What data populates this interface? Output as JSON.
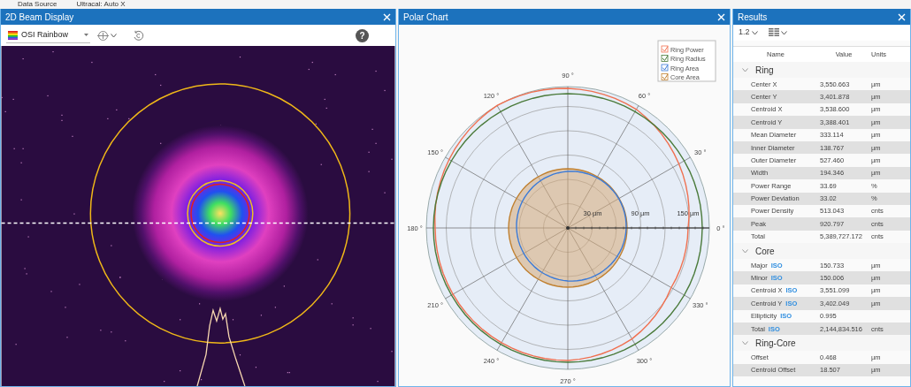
{
  "menu_bar": {
    "items": [
      "Data Source",
      "Ultracal: Auto X"
    ]
  },
  "beam_display": {
    "title": "2D Beam Display",
    "palette": "OSI Rainbow",
    "help": "?"
  },
  "polar_chart": {
    "title": "Polar Chart",
    "legend": [
      {
        "label": "Ring Power",
        "color": "#f07050",
        "checked": true
      },
      {
        "label": "Ring Radius",
        "color": "#4a7a3a",
        "checked": true
      },
      {
        "label": "Ring Area",
        "color": "#3a7ad8",
        "checked": true
      },
      {
        "label": "Core Area",
        "color": "#c08030",
        "checked": true
      }
    ],
    "angle_labels": [
      "0 °",
      "30 °",
      "60 °",
      "90 °",
      "120 °",
      "150 °",
      "180 °",
      "210 °",
      "240 °",
      "270 °",
      "300 °",
      "330 °"
    ],
    "radius_labels": [
      "30 µm",
      "90 µm",
      "150 µm"
    ]
  },
  "results": {
    "title": "Results",
    "precision": "1.2",
    "columns": [
      "Name",
      "Value",
      "Units"
    ],
    "groups": [
      {
        "name": "Ring",
        "expanded": true,
        "rows": [
          {
            "name": "Center X",
            "value": "3,550.663",
            "unit": "µm"
          },
          {
            "name": "Center Y",
            "value": "3,401.878",
            "unit": "µm"
          },
          {
            "name": "Centroid X",
            "value": "3,538.600",
            "unit": "µm"
          },
          {
            "name": "Centroid Y",
            "value": "3,388.401",
            "unit": "µm"
          },
          {
            "name": "Mean Diameter",
            "value": "333.114",
            "unit": "µm"
          },
          {
            "name": "Inner Diameter",
            "value": "138.767",
            "unit": "µm"
          },
          {
            "name": "Outer Diameter",
            "value": "527.460",
            "unit": "µm"
          },
          {
            "name": "Width",
            "value": "194.346",
            "unit": "µm"
          },
          {
            "name": "Power Range",
            "value": "33.69",
            "unit": "%"
          },
          {
            "name": "Power Deviation",
            "value": "33.02",
            "unit": "%"
          },
          {
            "name": "Power Density",
            "value": "513.043",
            "unit": "cnts"
          },
          {
            "name": "Peak",
            "value": "920.797",
            "unit": "cnts"
          },
          {
            "name": "Total",
            "value": "5,389,727.172",
            "unit": "cnts"
          }
        ]
      },
      {
        "name": "Core",
        "expanded": true,
        "rows": [
          {
            "name": "Major",
            "tag": "ISO",
            "value": "150.733",
            "unit": "µm"
          },
          {
            "name": "Minor",
            "tag": "ISO",
            "value": "150.006",
            "unit": "µm"
          },
          {
            "name": "Centroid X",
            "tag": "ISO",
            "value": "3,551.099",
            "unit": "µm"
          },
          {
            "name": "Centroid Y",
            "tag": "ISO",
            "value": "3,402.049",
            "unit": "µm"
          },
          {
            "name": "Ellipticity",
            "tag": "ISO",
            "value": "0.995"
          },
          {
            "name": "Total",
            "tag": "ISO",
            "value": "2,144,834.516",
            "unit": "cnts"
          }
        ]
      },
      {
        "name": "Ring-Core",
        "expanded": true,
        "rows": [
          {
            "name": "Offset",
            "value": "0.468",
            "unit": "µm"
          },
          {
            "name": "Centroid Offset",
            "value": "18.507",
            "unit": "µm"
          }
        ]
      }
    ]
  }
}
